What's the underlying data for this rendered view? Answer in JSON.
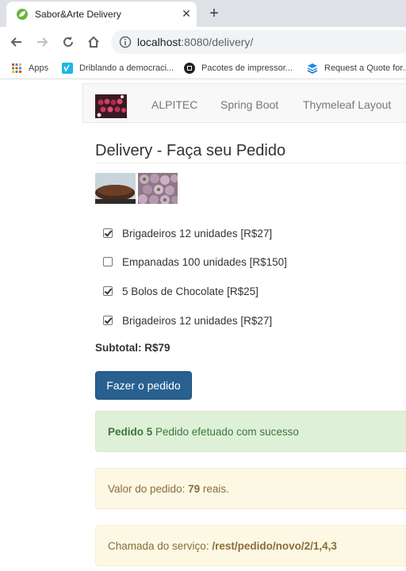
{
  "browser": {
    "tab_title": "Sabor&Arte Delivery",
    "url_host": "localhost",
    "url_rest": ":8080/delivery/",
    "bookmarks": [
      {
        "label": "Apps",
        "icon": "apps-grid-icon"
      },
      {
        "label": "Driblando a democraci...",
        "icon": "vimeo-icon"
      },
      {
        "label": "Pacotes de impressor...",
        "icon": "printer-icon"
      },
      {
        "label": "Request a Quote for...",
        "icon": "stack-icon"
      }
    ]
  },
  "navbar": {
    "links": [
      "ALPITEC",
      "Spring Boot",
      "Thymeleaf Layout"
    ]
  },
  "page": {
    "title": "Delivery - Faça seu Pedido",
    "items": [
      {
        "label": "Brigadeiros 12 unidades [R$27]",
        "checked": true
      },
      {
        "label": "Empanadas 100 unidades [R$150]",
        "checked": false
      },
      {
        "label": "5 Bolos de Chocolate [R$25]",
        "checked": true
      },
      {
        "label": "Brigadeiros 12 unidades [R$27]",
        "checked": true
      }
    ],
    "subtotal": "Subtotal: R$79",
    "order_button": "Fazer o pedido"
  },
  "alerts": {
    "success_bold": "Pedido 5",
    "success_text": " Pedido efetuado com sucesso",
    "value_prefix": "Valor do pedido: ",
    "value_amount": "79",
    "value_suffix": " reais.",
    "service_prefix": "Chamada do serviço: ",
    "service_path": "/rest/pedido/novo/2/1,4,3"
  },
  "colors": {
    "primary": "#286090",
    "success_bg": "#dff0d8",
    "warning_bg": "#fcf8e3"
  }
}
